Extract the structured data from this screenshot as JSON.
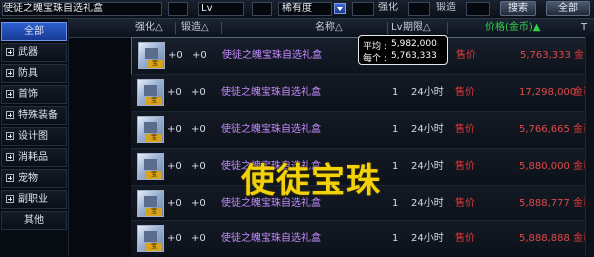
{
  "toolbar": {
    "search_value": "使徒之魄宝珠自选礼盒",
    "lv_label": "Lv",
    "rarity_label": "稀有度",
    "strengthen_label": "强化",
    "forge_label": "锻造",
    "search_button": "搜索",
    "all_button": "全部"
  },
  "sidebar": {
    "items": [
      {
        "label": "全部",
        "has_plus": false,
        "selected": true
      },
      {
        "label": "武器",
        "has_plus": true
      },
      {
        "label": "防具",
        "has_plus": true
      },
      {
        "label": "首饰",
        "has_plus": true
      },
      {
        "label": "特殊装备",
        "has_plus": true
      },
      {
        "label": "设计图",
        "has_plus": true
      },
      {
        "label": "消耗品",
        "has_plus": true
      },
      {
        "label": "宠物",
        "has_plus": true
      },
      {
        "label": "副职业",
        "has_plus": true
      },
      {
        "label": "其他",
        "has_plus": false
      }
    ]
  },
  "table": {
    "headers": {
      "strengthen": "强化△",
      "forge": "锻造△",
      "name": "名称△",
      "lv": "Lv",
      "period": "期限△",
      "price": "价格(金币)▲",
      "extra": "T"
    },
    "rows": [
      {
        "icon_tag": "宝",
        "strengthen": "+0",
        "forge": "+0",
        "name": "使徒之魄宝珠自选礼盒",
        "lv": "",
        "time": "",
        "sell": "售价",
        "price": "5,763,333",
        "currency": "金币"
      },
      {
        "icon_tag": "宝",
        "strengthen": "+0",
        "forge": "+0",
        "name": "使徒之魄宝珠自选礼盒",
        "lv": "1",
        "time": "24小时",
        "sell": "售价",
        "price": "17,298,000",
        "currency": "金币"
      },
      {
        "icon_tag": "宝",
        "strengthen": "+0",
        "forge": "+0",
        "name": "使徒之魄宝珠自选礼盒",
        "lv": "1",
        "time": "24小时",
        "sell": "售价",
        "price": "5,766,665",
        "currency": "金币"
      },
      {
        "icon_tag": "宝",
        "strengthen": "+0",
        "forge": "+0",
        "name": "使徒之魄宝珠自选礼盒",
        "lv": "1",
        "time": "24小时",
        "sell": "售价",
        "price": "5,880,000",
        "currency": "金币"
      },
      {
        "icon_tag": "宝",
        "strengthen": "+0",
        "forge": "+0",
        "name": "使徒之魄宝珠自选礼盒",
        "lv": "1",
        "time": "24小时",
        "sell": "售价",
        "price": "5,888,777",
        "currency": "金币"
      },
      {
        "icon_tag": "宝",
        "strengthen": "+0",
        "forge": "+0",
        "name": "使徒之魄宝珠自选礼盒",
        "lv": "1",
        "time": "24小时",
        "sell": "售价",
        "price": "5,888,888",
        "currency": "金币"
      }
    ]
  },
  "tooltip": {
    "avg_label": "平均 :",
    "avg_value": "5,982,000",
    "each_label": "每个 :",
    "each_value": "5,763,333"
  },
  "overlay_text": "使徒宝珠"
}
